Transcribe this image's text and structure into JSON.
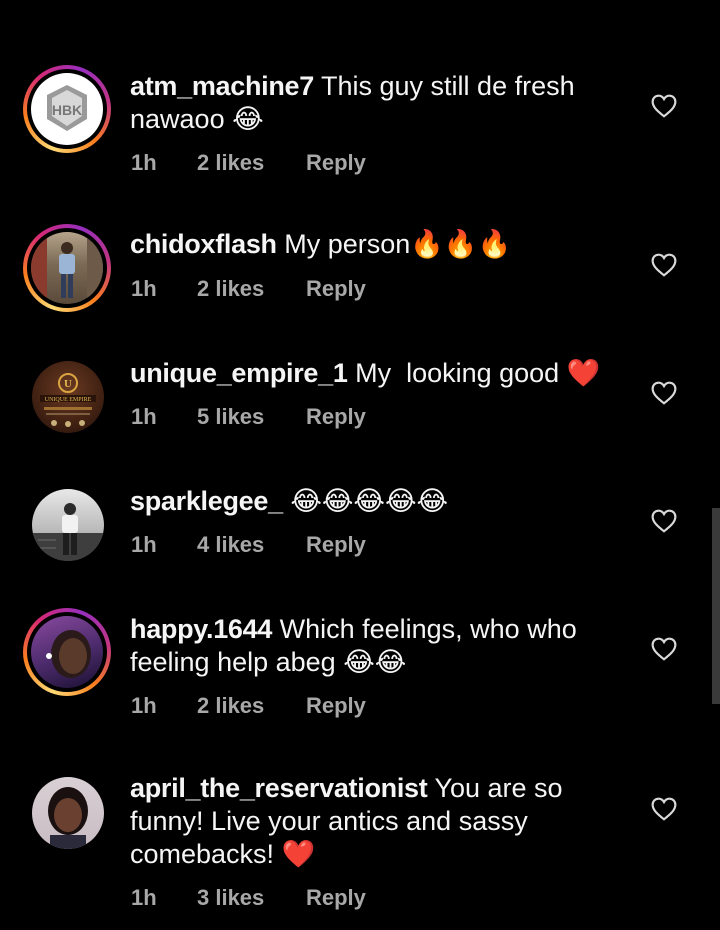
{
  "comments": [
    {
      "username": "atm_machine7",
      "text": " This guy still de fresh nawaoo ",
      "emoji": "😂",
      "time": "1h",
      "likes": "2 likes",
      "reply": "Reply",
      "avatar_badge": "HBK"
    },
    {
      "username": "chidoxflash",
      "text": " My person",
      "emoji": "🔥🔥🔥",
      "time": "1h",
      "likes": "2 likes",
      "reply": "Reply"
    },
    {
      "username": "unique_empire_1",
      "text": " My  looking good ",
      "emoji": "❤️",
      "time": "1h",
      "likes": "5 likes",
      "reply": "Reply",
      "avatar_badge": "UNIQUE EMPIRE"
    },
    {
      "username": "sparklegee_",
      "text": " ",
      "emoji": "😂😂😂😂😂",
      "time": "1h",
      "likes": "4 likes",
      "reply": "Reply"
    },
    {
      "username": "happy.1644",
      "text": " Which feelings, who who feeling help abeg ",
      "emoji": "😂😂",
      "time": "1h",
      "likes": "2 likes",
      "reply": "Reply"
    },
    {
      "username": "april_the_reservationist",
      "text": " You are so funny! Live your antics and sassy comebacks! ",
      "emoji": "❤️",
      "time": "1h",
      "likes": "3 likes",
      "reply": "Reply"
    }
  ],
  "icons": {
    "like": "heart-outline-icon"
  },
  "colors": {
    "background": "#000000",
    "text": "#f5f5f5",
    "meta": "#a8a8a8",
    "heart_red": "#e8262c"
  }
}
